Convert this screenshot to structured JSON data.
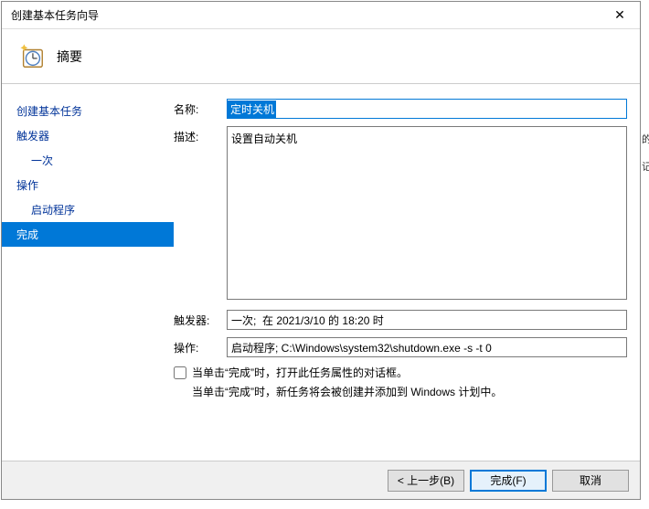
{
  "window": {
    "title": "创建基本任务向导"
  },
  "header": {
    "title": "摘要"
  },
  "sidebar": {
    "items": [
      {
        "label": "创建基本任务",
        "sub": false,
        "active": false
      },
      {
        "label": "触发器",
        "sub": false,
        "active": false
      },
      {
        "label": "一次",
        "sub": true,
        "active": false
      },
      {
        "label": "操作",
        "sub": false,
        "active": false
      },
      {
        "label": "启动程序",
        "sub": true,
        "active": false
      },
      {
        "label": "完成",
        "sub": false,
        "active": true
      }
    ]
  },
  "form": {
    "name_label": "名称:",
    "name_value": "定时关机",
    "desc_label": "描述:",
    "desc_value": "设置自动关机",
    "trigger_label": "触发器:",
    "trigger_value": "一次;  在 2021/3/10 的 18:20 时",
    "action_label": "操作:",
    "action_value": "启动程序; C:\\Windows\\system32\\shutdown.exe -s -t 0",
    "checkbox_label": "当单击“完成”时，打开此任务属性的对话框。",
    "checkbox_checked": false,
    "info_text": "当单击“完成”时，新任务将会被创建并添加到 Windows 计划中。"
  },
  "footer": {
    "back": "< 上一步(B)",
    "finish": "完成(F)",
    "cancel": "取消"
  },
  "gutter": {
    "a": "的",
    "b": "记"
  }
}
